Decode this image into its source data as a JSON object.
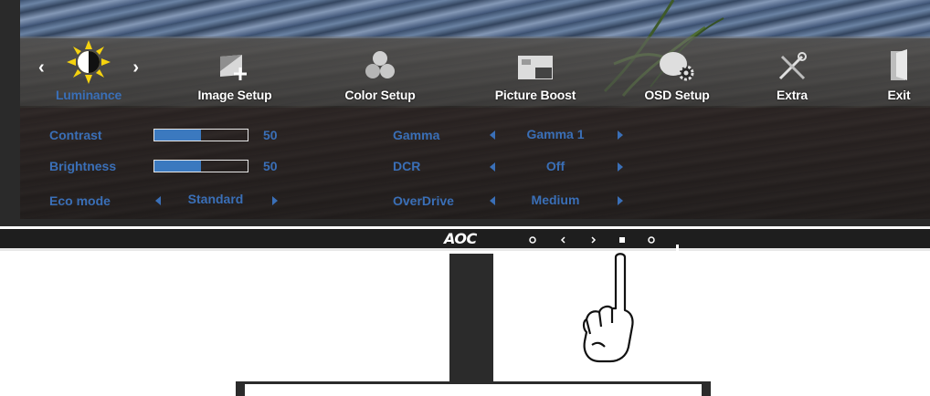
{
  "menu": {
    "items": [
      {
        "label": "Luminance",
        "icon": "sun-contrast-icon",
        "active": true
      },
      {
        "label": "Image Setup",
        "icon": "image-crop-icon",
        "active": false
      },
      {
        "label": "Color Setup",
        "icon": "rgb-spheres-icon",
        "active": false
      },
      {
        "label": "Picture Boost",
        "icon": "picture-boost-icon",
        "active": false
      },
      {
        "label": "OSD Setup",
        "icon": "osd-gear-icon",
        "active": false
      },
      {
        "label": "Extra",
        "icon": "tools-icon",
        "active": false
      },
      {
        "label": "Exit",
        "icon": "exit-door-icon",
        "active": false
      }
    ]
  },
  "settings": {
    "contrast": {
      "label": "Contrast",
      "value": "50",
      "level": 0.5
    },
    "brightness": {
      "label": "Brightness",
      "value": "50",
      "level": 0.5
    },
    "eco_mode": {
      "label": "Eco mode",
      "value": "Standard"
    },
    "gamma": {
      "label": "Gamma",
      "value": "Gamma 1"
    },
    "dcr": {
      "label": "DCR",
      "value": "Off"
    },
    "overdrive": {
      "label": "OverDrive",
      "value": "Medium"
    }
  },
  "bezel": {
    "logo": "AOC"
  },
  "colors": {
    "accent": "#3a6fb7",
    "slider_fill": "#3b79bf",
    "sun": "#f5d20f"
  }
}
